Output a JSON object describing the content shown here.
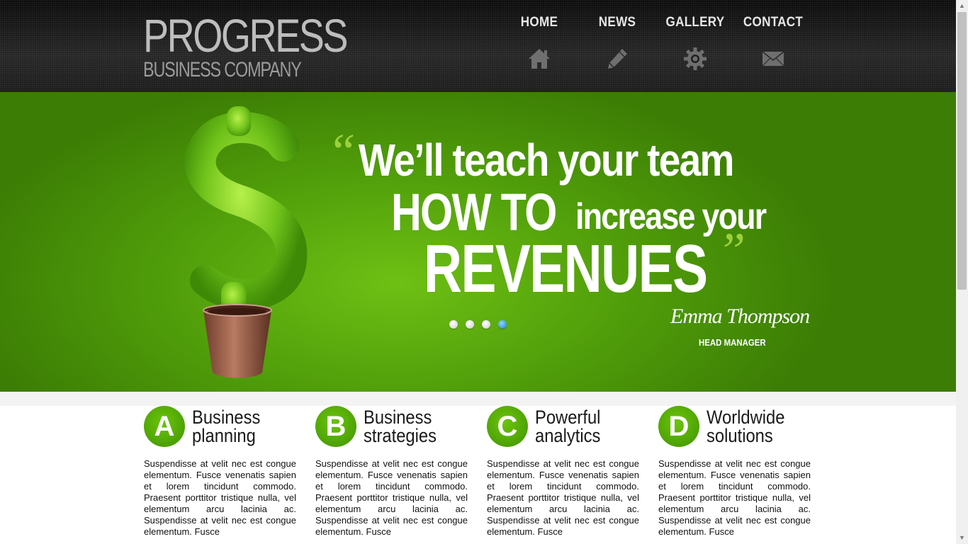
{
  "brand": {
    "title": "PROGRESS",
    "subtitle": "BUSINESS COMPANY"
  },
  "nav": {
    "items": [
      {
        "label": "HOME",
        "icon": "home-icon"
      },
      {
        "label": "NEWS",
        "icon": "pencil-icon"
      },
      {
        "label": "GALLERY",
        "icon": "gear-icon"
      },
      {
        "label": "CONTACT",
        "icon": "envelope-icon"
      }
    ]
  },
  "hero": {
    "quote_open": "“",
    "line1": "We’ll teach your team",
    "line2a": "HOW TO",
    "line2b": "increase your",
    "line3": "REVENUES",
    "quote_close": "”",
    "author": "Emma Thompson",
    "role": "HEAD MANAGER",
    "slides_total": 4,
    "active_slide": 4
  },
  "features": [
    {
      "letter": "A",
      "title_line1": "Business",
      "title_line2": "planning",
      "text": "Suspendisse at velit nec est congue elementum. Fusce venenatis sapien et lorem tincidunt commodo. Praesent porttitor tristique nulla, vel elementum arcu lacinia ac. Suspendisse at velit nec est congue elementum. Fusce"
    },
    {
      "letter": "B",
      "title_line1": "Business",
      "title_line2": "strategies",
      "text": "Suspendisse at velit nec est congue elementum. Fusce venenatis sapien et lorem tincidunt commodo. Praesent porttitor tristique nulla, vel elementum arcu lacinia ac. Suspendisse at velit nec est congue elementum. Fusce"
    },
    {
      "letter": "C",
      "title_line1": "Powerful",
      "title_line2": "analytics",
      "text": "Suspendisse at velit nec est congue elementum. Fusce venenatis sapien et lorem tincidunt commodo. Praesent porttitor tristique nulla, vel elementum arcu lacinia ac. Suspendisse at velit nec est congue elementum. Fusce"
    },
    {
      "letter": "D",
      "title_line1": "Worldwide",
      "title_line2": "solutions",
      "text": "Suspendisse at velit nec est congue elementum. Fusce venenatis sapien et lorem tincidunt commodo. Praesent porttitor tristique nulla, vel elementum arcu lacinia ac. Suspendisse at velit nec est congue elementum. Fusce"
    }
  ],
  "colors": {
    "accent_green": "#5cb50a",
    "header_dark": "#1a1a1a",
    "nav_text": "#e6e6e6",
    "dot_active": "#1b7fd6"
  }
}
